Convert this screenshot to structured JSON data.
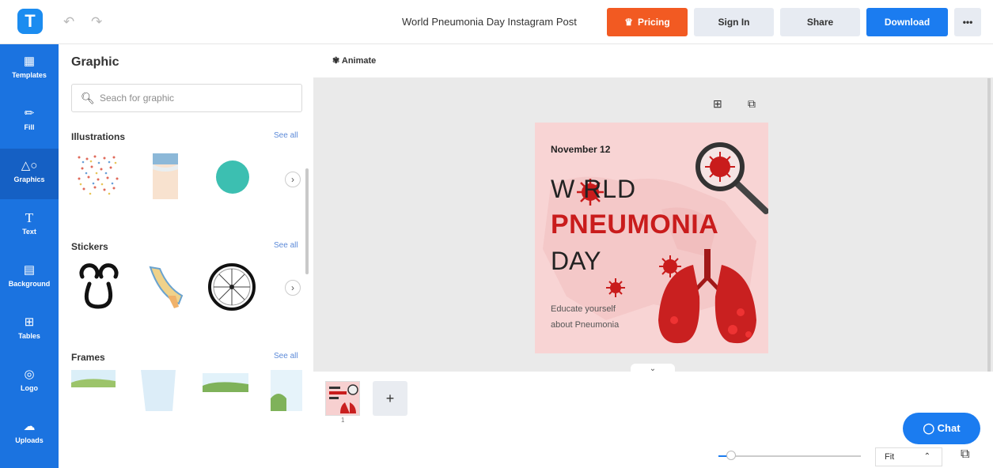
{
  "topbar": {
    "logo_letter": "T",
    "undo_icon": "undo-icon",
    "redo_icon": "redo-icon",
    "doc_title": "World Pneumonia Day Instagram Post",
    "pricing": "Pricing",
    "signin": "Sign In",
    "share": "Share",
    "download": "Download",
    "more": "•••"
  },
  "sidebar": {
    "items": [
      {
        "label": "Templates",
        "icon": "templates-icon"
      },
      {
        "label": "Fill",
        "icon": "brush-icon"
      },
      {
        "label": "Graphics",
        "icon": "graphics-icon"
      },
      {
        "label": "Text",
        "icon": "text-icon"
      },
      {
        "label": "Background",
        "icon": "background-icon"
      },
      {
        "label": "Tables",
        "icon": "table-icon"
      },
      {
        "label": "Logo",
        "icon": "logo-icon"
      },
      {
        "label": "Uploads",
        "icon": "upload-icon"
      }
    ]
  },
  "panel": {
    "title": "Graphic",
    "search_placeholder": "Seach for graphic",
    "sections": [
      {
        "title": "Illustrations",
        "see_all": "See all"
      },
      {
        "title": "Stickers",
        "see_all": "See all"
      },
      {
        "title": "Frames",
        "see_all": "See all"
      }
    ]
  },
  "toolbar": {
    "animate": "Animate"
  },
  "poster": {
    "date": "November 12",
    "world": "W  RLD",
    "pneumonia": "PNEUMONIA",
    "day": "DAY",
    "sub1": "Educate yourself",
    "sub2": "about Pneumonia"
  },
  "pages": {
    "current_page": "1",
    "add": "+"
  },
  "chat": "Chat",
  "zoom": {
    "value": "Fit",
    "level": 0.06
  },
  "colors": {
    "brand_blue": "#1b7cf0",
    "pricing_orange": "#f25a22",
    "poster_red": "#c91c1c",
    "poster_pink": "#f8d4d4"
  }
}
